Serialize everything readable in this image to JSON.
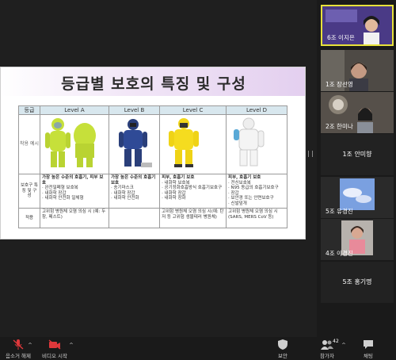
{
  "slide": {
    "title": "등급별 보호의 특징 및 구성",
    "header": [
      "등급",
      "Level A",
      "Level B",
      "Level C",
      "Level D"
    ],
    "row_labels": [
      "착용 예시",
      "보호구 특징 및 구성",
      "적용"
    ],
    "protection": [
      {
        "bold": "가장 높은 수준의 호흡기, 피부 보호",
        "items": "· 완전밀폐형 보호복\n· 내화학 장갑\n· 내화학 안전화 일체형"
      },
      {
        "bold": "가장 높은 수준의 호흡기 보호",
        "items": "· 송기마스크\n· 내화학 장갑\n· 내화학 안전화"
      },
      {
        "bold": "피부, 호흡기 보호",
        "items": "· 내화학 보호복\n· 공기정화호흡방식 호흡기보호구\n· 내화학 장갑\n· 내화학 장화"
      },
      {
        "bold": "피부, 호흡기 보호",
        "items": "· 전신보호복\n· N95 동급의 호흡기보호구\n· 장갑\n· 보안경 또는 안면보호구\n· 신발덮개"
      }
    ],
    "use": [
      "고위험 병원체 오염 의심 시 (예: 두창, 페스트)",
      "",
      "고위험 병원체 오염 의심 시(예: 탄저 등 고위험 생물테러 병원체)",
      "고위험 병원체 오염 의심 시(SARS, MERS CoV 등)"
    ]
  },
  "participants": [
    {
      "name": "6조 이지은",
      "active": true
    },
    {
      "name": "1조 장선영",
      "active": false
    },
    {
      "name": "2조 한미나",
      "active": false
    },
    {
      "name": "1조 안미향",
      "active": false
    },
    {
      "name": "5조 유경진",
      "active": false
    },
    {
      "name": "4조 이경진",
      "active": false
    },
    {
      "name": "5조 홍기명",
      "active": false
    }
  ],
  "toolbar": {
    "mute_label": "음소거 해제",
    "video_label": "비디오 시작",
    "security_label": "보안",
    "participants_label": "참가자",
    "participants_count": "42",
    "chat_label": "채팅"
  },
  "colors": {
    "accent_border": "#e8e23a",
    "unmute_red": "#e0383b"
  }
}
